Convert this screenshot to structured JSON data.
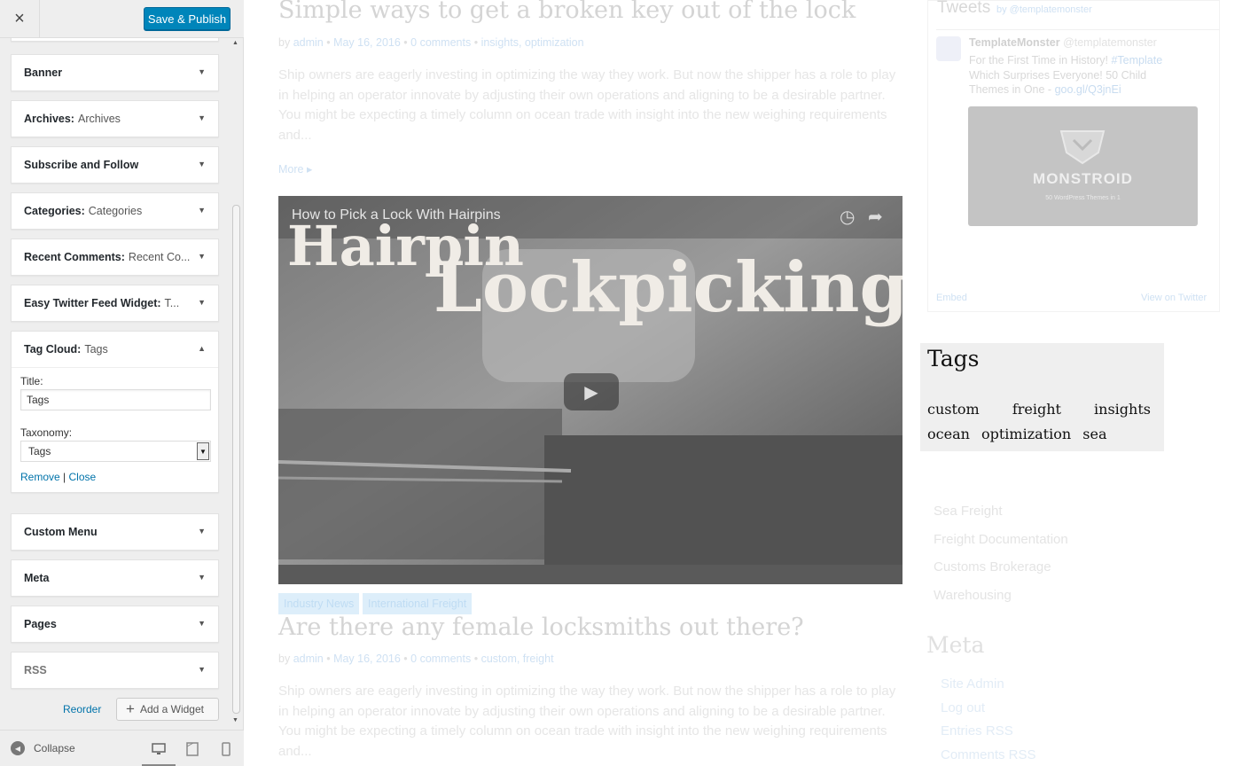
{
  "panel": {
    "close_label": "×",
    "publish_label": "Save & Publish",
    "widgets": [
      {
        "name": "Banner",
        "sub": ""
      },
      {
        "name": "Archives:",
        "sub": "Archives"
      },
      {
        "name": "Subscribe and Follow",
        "sub": ""
      },
      {
        "name": "Categories:",
        "sub": "Categories"
      },
      {
        "name": "Recent Comments:",
        "sub": "Recent Co..."
      },
      {
        "name": "Easy Twitter Feed Widget:",
        "sub": "T..."
      },
      {
        "name": "Tag Cloud:",
        "sub": "Tags"
      },
      {
        "name": "Custom Menu",
        "sub": ""
      },
      {
        "name": "Meta",
        "sub": ""
      },
      {
        "name": "Pages",
        "sub": ""
      },
      {
        "name": "RSS",
        "sub": ""
      }
    ],
    "tag_cloud_form": {
      "title_label": "Title:",
      "title_value": "Tags",
      "taxonomy_label": "Taxonomy:",
      "taxonomy_value": "Tags",
      "remove_label": "Remove",
      "separator": "|",
      "close_label": "Close"
    },
    "reorder_label": "Reorder",
    "add_widget_label": "Add a Widget",
    "collapse_label": "Collapse"
  },
  "preview": {
    "post1": {
      "title": "Simple ways to get a broken key out of the lock",
      "by": "by",
      "author": "admin",
      "date": "May 16, 2016",
      "comments": "0 comments",
      "tags": "insights, optimization",
      "excerpt": "Ship owners are eagerly investing in optimizing the way they work. But now the shipper has a role to play in helping an operator innovate by adjusting their own operations and aligning to be a desirable partner. You might be expecting a timely column on ocean trade with insight into the new weighing requirements and...",
      "more": "More"
    },
    "video": {
      "title": "How to Pick a Lock With Hairpins",
      "overlay_line1": "Hairpin",
      "overlay_line2": "Lockpicking"
    },
    "post2": {
      "categories": [
        "Industry News",
        "International Freight"
      ],
      "title": "Are there any female locksmiths out there?",
      "by": "by",
      "author": "admin",
      "date": "May 16, 2016",
      "comments": "0 comments",
      "tags": "custom, freight",
      "excerpt": "Ship owners are eagerly investing in optimizing the way they work. But now the shipper has a role to play in helping an operator innovate by adjusting their own operations and aligning to be a desirable partner. You might be expecting a timely column on ocean trade with insight into the new weighing requirements and..."
    },
    "tweets": {
      "heading": "Tweets",
      "by": "by @templatemonster",
      "account": "TemplateMonster",
      "handle": "@templatemonster",
      "text": "For the First Time in History!",
      "hashtag": "#Template",
      "text2": "Which Surprises Everyone! 50 Child Themes in One -",
      "link": "goo.gl/Q3jnEi",
      "card_title": "MONSTROID",
      "card_sub": "50 WordPress Themes in 1",
      "embed": "Embed",
      "view": "View on Twitter"
    },
    "tag_cloud": {
      "heading": "Tags",
      "tags": [
        "custom",
        "freight",
        "insights",
        "ocean",
        "optimization",
        "sea"
      ]
    },
    "menu": [
      "Sea Freight",
      "Freight Documentation",
      "Customs Brokerage",
      "Warehousing"
    ],
    "meta": {
      "heading": "Meta",
      "items": [
        "Site Admin",
        "Log out",
        "Entries RSS",
        "Comments RSS"
      ]
    }
  }
}
